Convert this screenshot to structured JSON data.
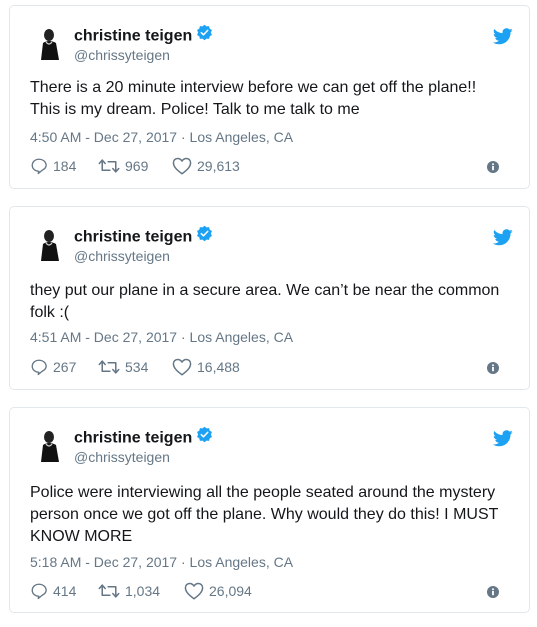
{
  "colors": {
    "twitter_blue": "#1da1f2",
    "secondary_text": "#657786",
    "border": "#e1e8ed"
  },
  "icons": [
    "avatar",
    "verified-badge-icon",
    "twitter-bird-icon",
    "reply-icon",
    "retweet-icon",
    "like-icon",
    "info-icon"
  ],
  "tweets": [
    {
      "name": "christine teigen",
      "handle": "@chrissyteigen",
      "text_lines": [
        "There is a 20 minute interview before we can get off the plane!!",
        "This is my dream. Police! Talk to me talk to me"
      ],
      "time": "4:50 AM - Dec 27, 2017",
      "location": "Los Angeles, CA",
      "replies": "184",
      "retweets": "969",
      "likes": "29,613"
    },
    {
      "name": "christine teigen",
      "handle": "@chrissyteigen",
      "text_lines": [
        "they put our plane in a secure area. We can’t be near the common",
        "folk :("
      ],
      "time": "4:51 AM - Dec 27, 2017",
      "location": "Los Angeles, CA",
      "replies": "267",
      "retweets": "534",
      "likes": "16,488"
    },
    {
      "name": "christine teigen",
      "handle": "@chrissyteigen",
      "text_lines": [
        "Police were interviewing all the people seated around the mystery",
        "person once we got off the plane. Why would they do this! I MUST",
        "KNOW MORE"
      ],
      "time": "5:18 AM - Dec 27, 2017",
      "location": "Los Angeles, CA",
      "replies": "414",
      "retweets": "1,034",
      "likes": "26,094"
    }
  ]
}
